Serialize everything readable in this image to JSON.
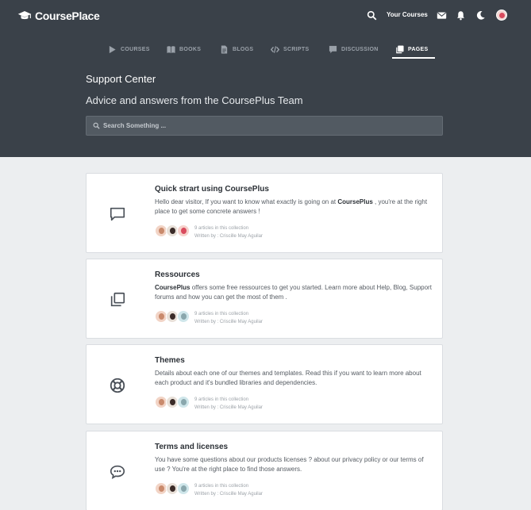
{
  "brand": {
    "name": "CoursePlace",
    "icon": "graduation-cap-icon"
  },
  "topbar": {
    "your_courses": "Your Courses",
    "icons": [
      "search-icon",
      "mail-icon",
      "bell-icon",
      "moon-icon",
      "avatar"
    ]
  },
  "nav": {
    "tabs": [
      {
        "label": "COURSES",
        "icon": "play-icon",
        "active": false
      },
      {
        "label": "BOOKS",
        "icon": "book-icon",
        "active": false
      },
      {
        "label": "BLOGS",
        "icon": "document-icon",
        "active": false
      },
      {
        "label": "SCRIPTS",
        "icon": "code-icon",
        "active": false
      },
      {
        "label": "DISCUSSION",
        "icon": "chat-icon",
        "active": false
      },
      {
        "label": "PAGES",
        "icon": "pages-icon",
        "active": true
      }
    ]
  },
  "hero": {
    "title": "Support Center",
    "subtitle": "Advice and answers from the CoursePlus Team",
    "search_placeholder": "Search Something ..."
  },
  "cards": [
    {
      "icon": "comment-icon",
      "title": "Quick strart using CoursePlus",
      "desc_prefix": "Hello dear visitor, If you want to know what exactly is going on at ",
      "desc_bold": "CoursePlus",
      "desc_suffix": " , you're at the right place to get some concrete answers !",
      "articles": "9 articles in this collection",
      "author": "Written by : Criscille May Aguilar"
    },
    {
      "icon": "copy-icon",
      "title": "Ressources",
      "desc_prefix": "",
      "desc_bold": "CoursePlus",
      "desc_suffix": " offers some free ressources to get you started. Learn more about Help, Blog, Support forums and how you can get the most of them .",
      "articles": "9 articles in this collection",
      "author": "Written by : Criscille May Aguilar"
    },
    {
      "icon": "lifebuoy-icon",
      "title": "Themes",
      "desc_prefix": "Details about each one of our themes and templates. Read this if you want to learn more about each product and it's bundled libraries and dependencies.",
      "desc_bold": "",
      "desc_suffix": "",
      "articles": "9 articles in this collection",
      "author": "Written by : Criscille May Aguilar"
    },
    {
      "icon": "speech-bubble-dots-icon",
      "title": "Terms and licenses",
      "desc_prefix": "You have some questions about our products licenses ? about our privacy policy or our terms of use ? You're at the right place to find those answers.",
      "desc_bold": "",
      "desc_suffix": "",
      "articles": "9 articles in this collection",
      "author": "Written by : Criscille May Aguilar"
    }
  ],
  "colors": {
    "header_bg": "#3a4149",
    "page_bg": "#eceef0",
    "card_bg": "#ffffff",
    "nav_inactive": "#9aa1a9"
  }
}
